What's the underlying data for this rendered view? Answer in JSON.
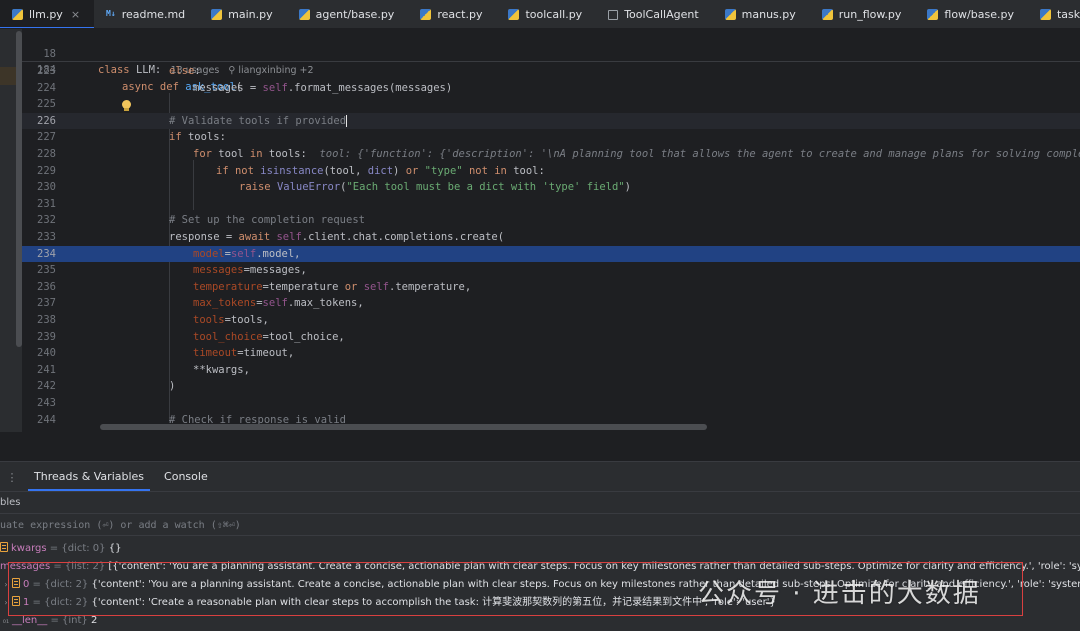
{
  "tabs": [
    {
      "label": "llm.py",
      "type": "py",
      "active": true,
      "closable": true
    },
    {
      "label": "readme.md",
      "type": "md"
    },
    {
      "label": "main.py",
      "type": "py"
    },
    {
      "label": "agent/base.py",
      "type": "py"
    },
    {
      "label": "react.py",
      "type": "py"
    },
    {
      "label": "toolcall.py",
      "type": "py"
    },
    {
      "label": "ToolCallAgent",
      "type": "cls"
    },
    {
      "label": "manus.py",
      "type": "py"
    },
    {
      "label": "run_flow.py",
      "type": "py"
    },
    {
      "label": "flow/base.py",
      "type": "py"
    },
    {
      "label": "tasks.py",
      "type": "py"
    }
  ],
  "md_badge": "M↓",
  "close_glyph": "×",
  "editor": {
    "sticky": [
      {
        "num": "18",
        "text": "class LLM:",
        "inlay": "13 usages   ⚲ liangxinbing +2"
      },
      {
        "num": "184",
        "text": "async def ask_tool("
      }
    ],
    "lines": {
      "l223": {
        "num": "223",
        "code": "else:"
      },
      "l224": {
        "num": "224",
        "code": "messages = self.format_messages(messages)"
      },
      "l225": {
        "num": "225",
        "code": ""
      },
      "l226": {
        "num": "226",
        "code": "# Validate tools if provided"
      },
      "l227": {
        "num": "227",
        "code": "if tools:"
      },
      "l228": {
        "num": "228",
        "code": "for tool in tools:",
        "hint": "tool: {'function': {'description': '\\nA planning tool that allows the agent to create and manage plans for solving complex tasks.\\n"
      },
      "l229": {
        "num": "229",
        "code": "if not isinstance(tool, dict) or \"type\" not in tool:"
      },
      "l230": {
        "num": "230",
        "code": "raise ValueError(\"Each tool must be a dict with 'type' field\")"
      },
      "l231": {
        "num": "231",
        "code": ""
      },
      "l232": {
        "num": "232",
        "code": "# Set up the completion request"
      },
      "l233": {
        "num": "233",
        "code": "response = await self.client.chat.completions.create("
      },
      "l234": {
        "num": "234",
        "code": "model=self.model,"
      },
      "l235": {
        "num": "235",
        "code": "messages=messages,"
      },
      "l236": {
        "num": "236",
        "code": "temperature=temperature or self.temperature,"
      },
      "l237": {
        "num": "237",
        "code": "max_tokens=self.max_tokens,"
      },
      "l238": {
        "num": "238",
        "code": "tools=tools,"
      },
      "l239": {
        "num": "239",
        "code": "tool_choice=tool_choice,"
      },
      "l240": {
        "num": "240",
        "code": "timeout=timeout,"
      },
      "l241": {
        "num": "241",
        "code": "**kwargs,"
      },
      "l242": {
        "num": "242",
        "code": ")"
      },
      "l243": {
        "num": "243",
        "code": ""
      },
      "l244": {
        "num": "244",
        "code": "# Check if response is valid"
      }
    }
  },
  "debug": {
    "tabs": [
      "Threads & Variables",
      "Console"
    ],
    "section": "bles",
    "eval_placeholder": "uate expression (⏎) or add a watch (⇧⌘⏎)",
    "vars": [
      {
        "name": "kwargs",
        "type": " = {dict: 0} ",
        "value": "{}"
      },
      {
        "name": "messages",
        "type": " = {list: 2} ",
        "value": "[{'content': 'You are a planning assistant. Create a concise, actionable plan with clear steps. Focus on key milestones rather than detailed sub-steps. Optimize for clarity and efficiency.', 'role': 'system'}, {'content':"
      },
      {
        "name": "0",
        "type": " = {dict: 2} ",
        "value": "{'content': 'You are a planning assistant. Create a concise, actionable plan with clear steps. Focus on key milestones rather than detailed sub-steps. Optimize for clarity and efficiency.', 'role': 'system'}"
      },
      {
        "name": "1",
        "type": " = {dict: 2} ",
        "value": "{'content': 'Create a reasonable plan with clear steps to accomplish the task: 计算斐波那契数列的第五位，并记录结果到文件中', 'role': 'user'}"
      },
      {
        "name": "__len__",
        "type": " = {int} ",
        "value": "2"
      }
    ]
  },
  "watermark": "公众号 · 进击的大数据"
}
